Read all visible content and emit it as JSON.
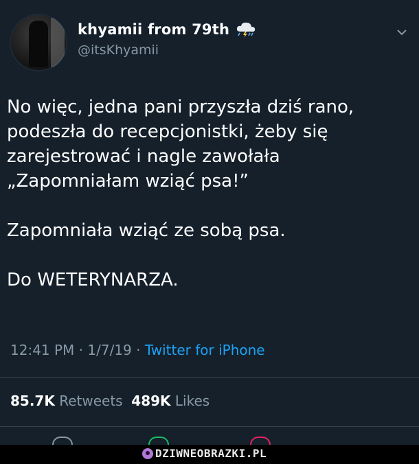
{
  "author": {
    "display_name": "khyamii from 79th",
    "handle": "@itsKhyamii",
    "badge_icon": "thunderstorm-cloud-icon"
  },
  "tweet": {
    "lines_p1": [
      "No więc, jedna pani przyszła dziś rano,",
      "podeszła do recepcjonistki, żeby się",
      "zarejestrować i nagle zawołała",
      "„Zapomniałam wziąć psa!”"
    ],
    "p2": "Zapomniała wziąć ze sobą psa.",
    "p3": "Do WETERYNARZA."
  },
  "meta": {
    "time": "12:41 PM",
    "sep": " · ",
    "date": "1/7/19",
    "source": "Twitter for iPhone"
  },
  "stats": {
    "retweets_count": "85.7K",
    "retweets_label": "Retweets",
    "likes_count": "489K",
    "likes_label": "Likes"
  },
  "watermark": {
    "text": "DZIWNEOBRAZKI.PL"
  },
  "colors": {
    "background": "#15202b",
    "link": "#1da1f2",
    "muted": "#8899a6"
  }
}
